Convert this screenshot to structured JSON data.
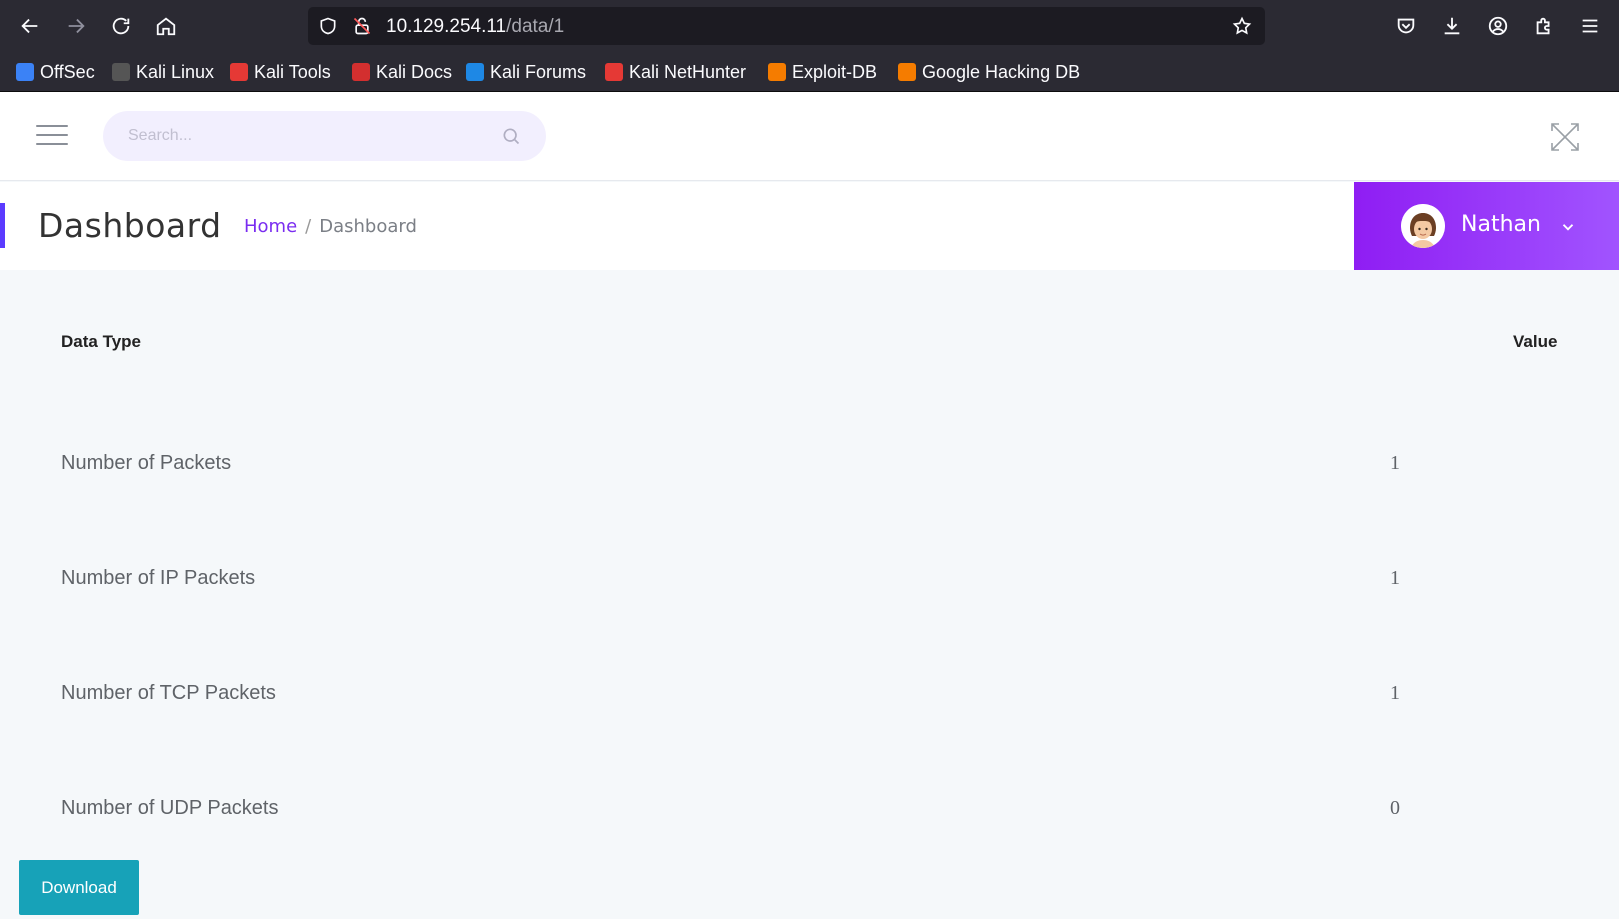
{
  "browser": {
    "url_host": "10.129.254.11",
    "url_path": "/data/1",
    "bookmarks": [
      {
        "label": "OffSec",
        "color": "#3b82f6"
      },
      {
        "label": "Kali Linux",
        "color": "#1a1a1a"
      },
      {
        "label": "Kali Tools",
        "color": "#e53935"
      },
      {
        "label": "Kali Docs",
        "color": "#d32f2f"
      },
      {
        "label": "Kali Forums",
        "color": "#1e88e5"
      },
      {
        "label": "Kali NetHunter",
        "color": "#e53935"
      },
      {
        "label": "Exploit-DB",
        "color": "#f57c00"
      },
      {
        "label": "Google Hacking DB",
        "color": "#f57c00"
      }
    ]
  },
  "topbar": {
    "search_placeholder": "Search..."
  },
  "header": {
    "title": "Dashboard",
    "breadcrumb_home": "Home",
    "breadcrumb_separator": "/",
    "breadcrumb_current": "Dashboard",
    "user_name": "Nathan"
  },
  "table": {
    "col_type": "Data Type",
    "col_value": "Value",
    "rows": [
      {
        "label": "Number of Packets",
        "value": "1"
      },
      {
        "label": "Number of IP Packets",
        "value": "1"
      },
      {
        "label": "Number of TCP Packets",
        "value": "1"
      },
      {
        "label": "Number of UDP Packets",
        "value": "0"
      }
    ]
  },
  "actions": {
    "download_label": "Download"
  },
  "colors": {
    "accent": "#5b3bff",
    "user_gradient_start": "#8f1df3",
    "user_gradient_end": "#a154ff",
    "download": "#17a2b8"
  }
}
